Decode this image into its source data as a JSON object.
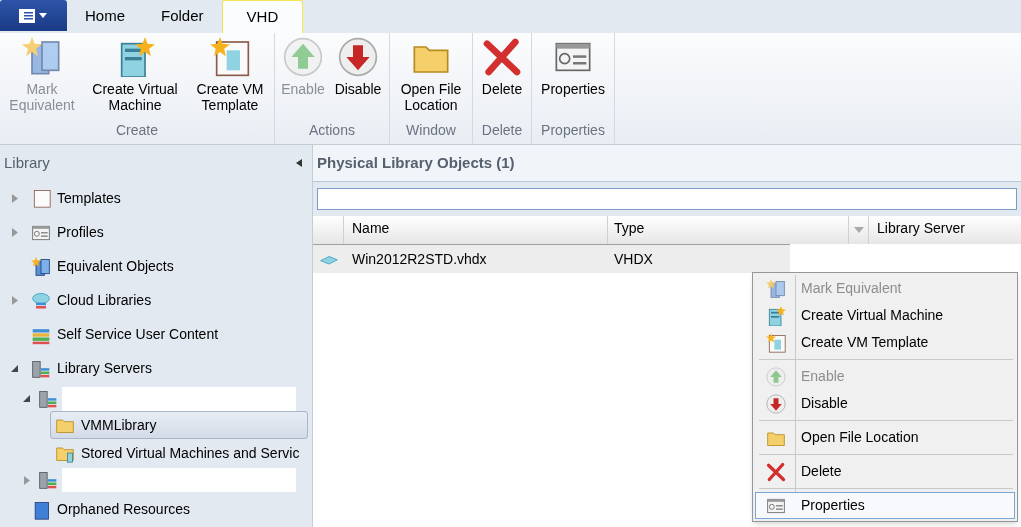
{
  "tabs": [
    {
      "label": "Home",
      "selected": false
    },
    {
      "label": "Folder",
      "selected": false
    },
    {
      "label": "VHD",
      "selected": true
    }
  ],
  "ribbon_groups": [
    {
      "label": "Create",
      "buttons": [
        {
          "label": "Mark Equivalent",
          "disabled": true
        },
        {
          "label": "Create Virtual Machine",
          "disabled": false
        },
        {
          "label": "Create VM Template",
          "disabled": false
        }
      ]
    },
    {
      "label": "Actions",
      "buttons": [
        {
          "label": "Enable",
          "disabled": true
        },
        {
          "label": "Disable",
          "disabled": false
        }
      ]
    },
    {
      "label": "Window",
      "buttons": [
        {
          "label": "Open File Location",
          "disabled": false
        }
      ]
    },
    {
      "label": "Delete",
      "buttons": [
        {
          "label": "Delete",
          "disabled": false
        }
      ]
    },
    {
      "label": "Properties",
      "buttons": [
        {
          "label": "Properties",
          "disabled": false
        }
      ]
    }
  ],
  "sidebar": {
    "title": "Library",
    "items": [
      {
        "kind": "node",
        "label": "Templates",
        "expanded": false,
        "selected": false
      },
      {
        "kind": "node",
        "label": "Profiles",
        "expanded": false,
        "selected": false
      },
      {
        "kind": "leaf",
        "label": "Equivalent Objects",
        "selected": false
      },
      {
        "kind": "node",
        "label": "Cloud Libraries",
        "expanded": false,
        "selected": false
      },
      {
        "kind": "leaf",
        "label": "Self Service User Content",
        "selected": false
      },
      {
        "kind": "node",
        "label": "Library Servers",
        "expanded": true,
        "selected": false,
        "children": [
          {
            "kind": "redacted",
            "expanded": true,
            "children": [
              {
                "kind": "leaf",
                "label": "VMMLibrary",
                "selected": true
              },
              {
                "kind": "leaf",
                "label": "Stored Virtual Machines and Servic",
                "selected": false
              }
            ]
          },
          {
            "kind": "redacted",
            "expanded": false
          }
        ]
      },
      {
        "kind": "leaf",
        "label": "Orphaned Resources",
        "selected": false
      }
    ]
  },
  "main": {
    "title": "Physical Library Objects (1)",
    "columns": [
      {
        "label": "Name"
      },
      {
        "label": "Type"
      },
      {
        "label": "Library Server"
      }
    ],
    "rows": [
      {
        "name": "Win2012R2STD.vhdx",
        "type": "VHDX",
        "selected": true
      }
    ]
  },
  "context_menu": {
    "items": [
      {
        "kind": "item",
        "label": "Mark Equivalent",
        "disabled": true,
        "selected": false
      },
      {
        "kind": "item",
        "label": "Create Virtual Machine",
        "disabled": false,
        "selected": false
      },
      {
        "kind": "item",
        "label": "Create VM Template",
        "disabled": false,
        "selected": false
      },
      {
        "kind": "separator"
      },
      {
        "kind": "item",
        "label": "Enable",
        "disabled": true,
        "selected": false
      },
      {
        "kind": "item",
        "label": "Disable",
        "disabled": false,
        "selected": false
      },
      {
        "kind": "separator"
      },
      {
        "kind": "item",
        "label": "Open File Location",
        "disabled": false,
        "selected": false
      },
      {
        "kind": "separator"
      },
      {
        "kind": "item",
        "label": "Delete",
        "disabled": false,
        "selected": false
      },
      {
        "kind": "separator"
      },
      {
        "kind": "item",
        "label": "Properties",
        "disabled": false,
        "selected": true
      }
    ]
  }
}
